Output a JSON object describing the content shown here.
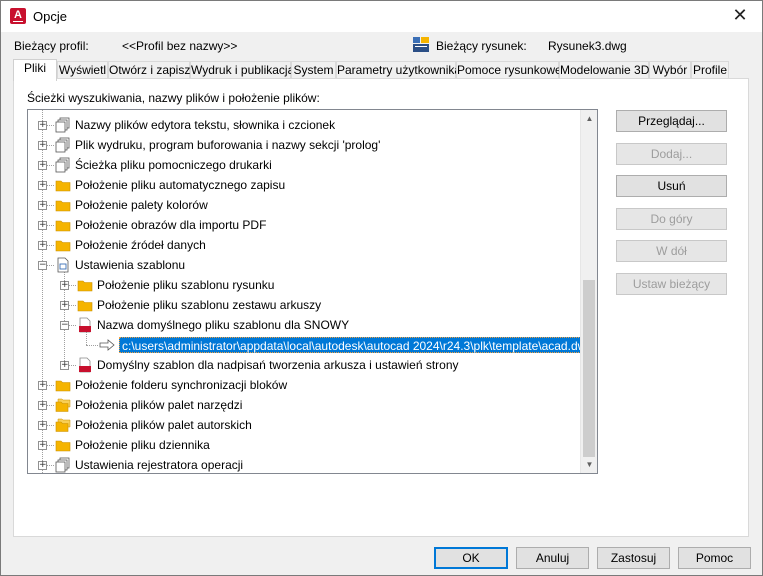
{
  "window": {
    "title": "Opcje",
    "close_symbol": "✕",
    "app_icon_letter": "A"
  },
  "profile": {
    "label": "Bieżący profil:",
    "value": "<<Profil bez nazwy>>"
  },
  "drawing": {
    "label": "Bieżący rysunek:",
    "value": "Rysunek3.dwg"
  },
  "tabs": [
    {
      "label": "Pliki"
    },
    {
      "label": "Wyświetl"
    },
    {
      "label": "Otwórz i zapisz"
    },
    {
      "label": "Wydruk i publikacja"
    },
    {
      "label": "System"
    },
    {
      "label": "Parametry użytkownika"
    },
    {
      "label": "Pomoce rysunkowe"
    },
    {
      "label": "Modelowanie 3D"
    },
    {
      "label": "Wybór"
    },
    {
      "label": "Profile"
    }
  ],
  "panel": {
    "label": "Ścieżki wyszukiwania, nazwy plików i położenie plików:"
  },
  "tree": {
    "rows": [
      {
        "text": "Nazwy plików edytora tekstu, słownika i czcionek",
        "icon": "files-icon"
      },
      {
        "text": "Plik wydruku, program buforowania i nazwy sekcji 'prolog'",
        "icon": "files-icon"
      },
      {
        "text": "Ścieżka pliku pomocniczego drukarki",
        "icon": "files-icon"
      },
      {
        "text": "Położenie pliku automatycznego zapisu",
        "icon": "folder-icon"
      },
      {
        "text": "Położenie palety kolorów",
        "icon": "folder-icon"
      },
      {
        "text": "Położenie obrazów dla importu PDF",
        "icon": "folder-icon"
      },
      {
        "text": "Położenie źródeł danych",
        "icon": "folder-icon"
      },
      {
        "text": "Ustawienia szablonu",
        "icon": "template-icon"
      },
      {
        "text": "Położenie pliku szablonu rysunku",
        "icon": "folder-icon"
      },
      {
        "text": "Położenie pliku szablonu zestawu arkuszy",
        "icon": "folder-icon"
      },
      {
        "text": "Nazwa domyślnego pliku szablonu dla SNOWY",
        "icon": "dwt-icon"
      },
      {
        "text": "c:\\users\\administrator\\appdata\\local\\autodesk\\autocad 2024\\r24.3\\plk\\template\\acad.dwt",
        "icon": "arrow-icon"
      },
      {
        "text": "Domyślny szablon dla nadpisań tworzenia arkusza i ustawień strony",
        "icon": "dwt-icon"
      },
      {
        "text": "Położenie folderu synchronizacji bloków",
        "icon": "folder-icon"
      },
      {
        "text": "Położenia plików palet narzędzi",
        "icon": "folders-icon"
      },
      {
        "text": "Położenia plików palet autorskich",
        "icon": "folders-icon"
      },
      {
        "text": "Położenie pliku dziennika",
        "icon": "folder-icon"
      },
      {
        "text": "Ustawienia rejestratora operacji",
        "icon": "files-icon"
      }
    ],
    "dwt_badge": "DWT",
    "expand_symbol": "+",
    "collapse_symbol": "−"
  },
  "side_buttons": {
    "browse": "Przeglądaj...",
    "add": "Dodaj...",
    "remove": "Usuń",
    "up": "Do góry",
    "down": "W dół",
    "set_current": "Ustaw bieżący"
  },
  "footer_buttons": {
    "ok": "OK",
    "cancel": "Anuluj",
    "apply": "Zastosuj",
    "help": "Pomoc"
  },
  "colors": {
    "selection": "#0078d7",
    "folder": "#f5b400",
    "dwt": "#c8102e",
    "accent": "#0078d7"
  }
}
